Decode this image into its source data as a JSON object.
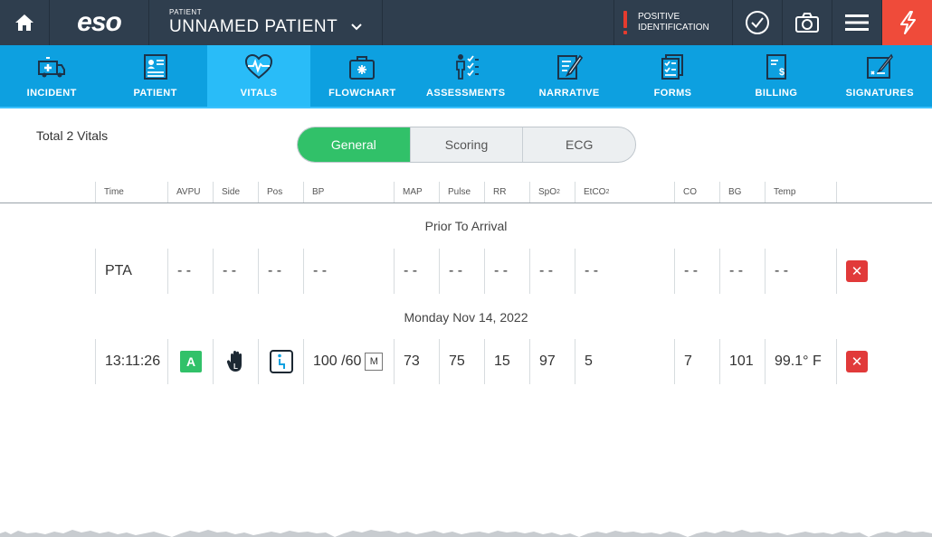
{
  "topbar": {
    "logo": "eso",
    "patient_label": "PATIENT",
    "patient_name": "UNNAMED PATIENT",
    "positive_id_line1": "POSITIVE",
    "positive_id_line2": "IDENTIFICATION",
    "icons": [
      "home-icon",
      "chevron-down-icon",
      "checkmark-icon",
      "camera-icon",
      "menu-icon",
      "lightning-icon"
    ]
  },
  "nav": [
    {
      "label": "INCIDENT",
      "icon": "ambulance-icon"
    },
    {
      "label": "PATIENT",
      "icon": "patient-card-icon"
    },
    {
      "label": "VITALS",
      "icon": "heart-pulse-icon",
      "active": true
    },
    {
      "label": "FLOWCHART",
      "icon": "medical-kit-icon"
    },
    {
      "label": "ASSESSMENTS",
      "icon": "assessment-icon"
    },
    {
      "label": "NARRATIVE",
      "icon": "narrative-pen-icon"
    },
    {
      "label": "FORMS",
      "icon": "forms-icon"
    },
    {
      "label": "BILLING",
      "icon": "billing-icon"
    },
    {
      "label": "SIGNATURES",
      "icon": "signature-icon"
    }
  ],
  "total_vitals": "Total 2 Vitals",
  "tabs": [
    "General",
    "Scoring",
    "ECG"
  ],
  "columns": {
    "time": "Time",
    "avpu": "AVPU",
    "side": "Side",
    "pos": "Pos",
    "bp": "BP",
    "map": "MAP",
    "pulse": "Pulse",
    "rr": "RR",
    "spo2": "SpO",
    "spo2_sub": "2",
    "etco2": "EtCO",
    "etco2_sub": "2",
    "co": "CO",
    "bg": "BG",
    "temp": "Temp"
  },
  "sections": {
    "prior": "Prior To Arrival",
    "date": "Monday Nov 14, 2022"
  },
  "rows": [
    {
      "time": "PTA",
      "avpu": "- -",
      "side": "- -",
      "pos": "- -",
      "bp": "- -",
      "map": "- -",
      "pulse": "- -",
      "rr": "- -",
      "spo2": "- -",
      "etco2": "- -",
      "co": "- -",
      "bg": "- -",
      "temp": "- -",
      "delete": "✕"
    },
    {
      "time": "13:11:26",
      "avpu": "A",
      "side_icon": "left-hand-icon",
      "pos_icon": "sitting-position-icon",
      "bp": "100 /60",
      "bp_method": "M",
      "map": "73",
      "pulse": "75",
      "rr": "15",
      "spo2": "97",
      "etco2": "5",
      "co": "7",
      "bg": "101",
      "temp": "99.1° F",
      "delete": "✕"
    }
  ],
  "colors": {
    "topbar": "#2f3e4e",
    "nav": "#0da0e0",
    "nav_active": "#29bcf8",
    "accent_green": "#31c169",
    "delete_red": "#e13a3a",
    "alert_red": "#ef4b3a"
  }
}
